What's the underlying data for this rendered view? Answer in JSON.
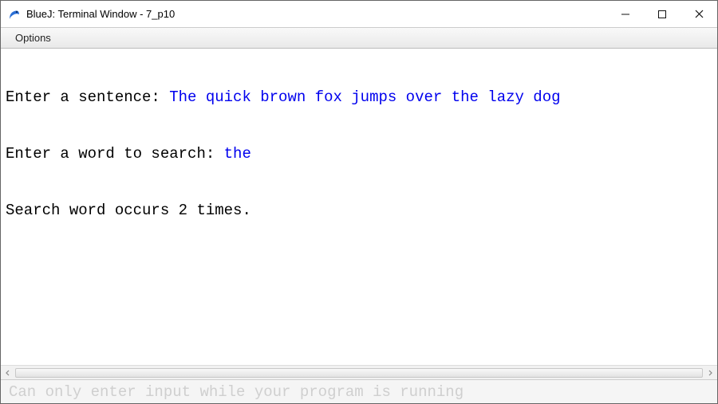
{
  "window": {
    "title": "BlueJ: Terminal Window - 7_p10"
  },
  "menubar": {
    "options": "Options"
  },
  "terminal": {
    "lines": [
      {
        "prompt": "Enter a sentence: ",
        "input": "The quick brown fox jumps over the lazy dog"
      },
      {
        "prompt": "Enter a word to search: ",
        "input": "the"
      },
      {
        "prompt": "Search word occurs 2 times.",
        "input": ""
      }
    ]
  },
  "footer": {
    "placeholder": "Can only enter input while your program is running"
  }
}
